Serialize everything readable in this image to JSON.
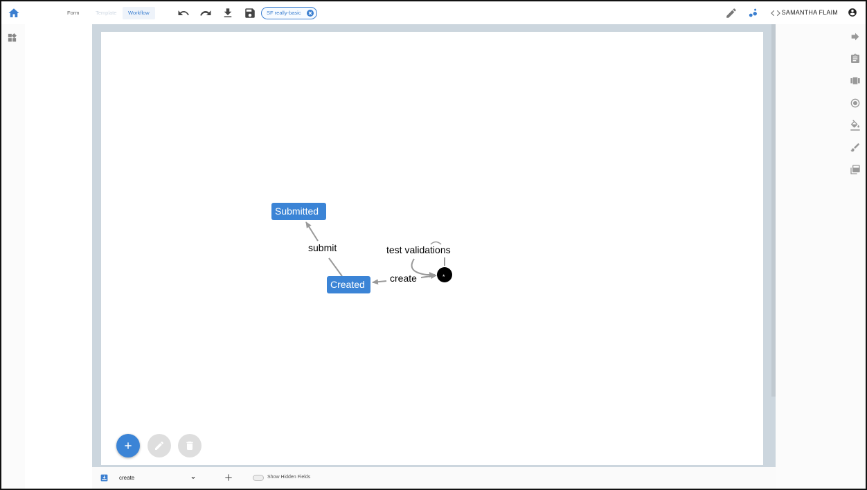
{
  "header": {
    "tabs": [
      {
        "label": "Form"
      },
      {
        "label": "Template"
      },
      {
        "label": "Workflow"
      }
    ],
    "chip_label": "SF really-basic",
    "user_name": "SAMANTHA FLAIM"
  },
  "workflow": {
    "states": [
      {
        "label": "Submitted"
      },
      {
        "label": "Created"
      },
      {
        "label": "*"
      }
    ],
    "transitions": [
      {
        "label": "submit"
      },
      {
        "label": "create"
      },
      {
        "label": "test validations"
      }
    ]
  },
  "bottom_bar": {
    "selected_transition": "create",
    "show_hidden_label": "Show Hidden Fields"
  },
  "colors": {
    "accent": "#3b84d6",
    "state_fill": "#3b84d6",
    "edge": "#999999"
  }
}
